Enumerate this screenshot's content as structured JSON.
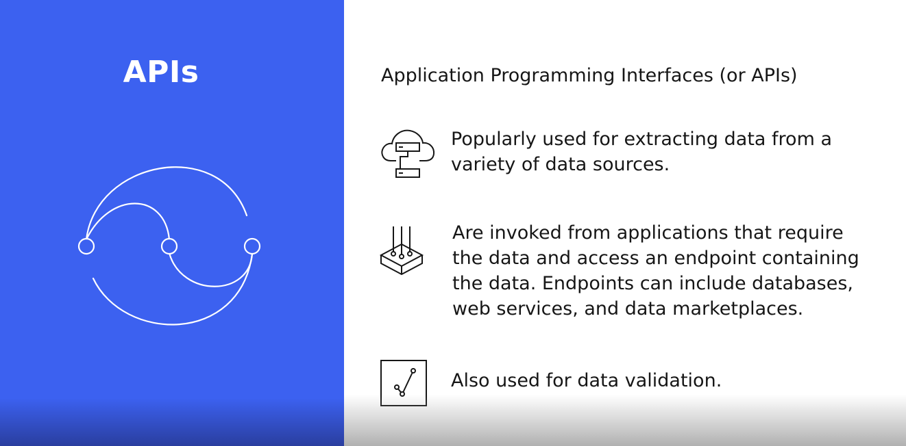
{
  "left": {
    "title": "APIs",
    "graphic_icon": "api-connection-icon",
    "accent": "#3c61f0"
  },
  "right": {
    "heading": "Application Programming Interfaces (or APIs)",
    "points": [
      {
        "icon": "cloud-data-source-icon",
        "lines": [
          "Popularly used for extracting data from a",
          "variety of data sources."
        ]
      },
      {
        "icon": "endpoint-icon",
        "lines": [
          "Are invoked from applications that require",
          "the data and access an endpoint containing",
          "the data. Endpoints can include databases,",
          "web services, and data marketplaces."
        ]
      },
      {
        "icon": "data-validation-icon",
        "lines": [
          "Also used for data validation."
        ]
      }
    ]
  }
}
